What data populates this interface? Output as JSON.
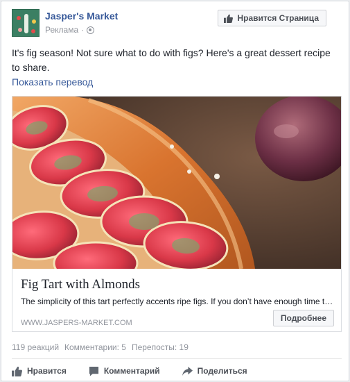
{
  "post": {
    "page_name": "Jasper's Market",
    "sponsored_label": "Реклама",
    "separator": "·",
    "like_page_label": "Нравится Страница",
    "text": "It's fig season! Not sure what to do with figs? Here's a great dessert recipe to share.",
    "translate_label": "Показать перевод"
  },
  "link": {
    "title": "Fig Tart with Almonds",
    "description": "The simplicity of this tart perfectly accents ripe figs. If you don’t have enough time t…",
    "domain": "WWW.JASPERS-MARKET.COM",
    "cta_label": "Подробнее"
  },
  "stats": {
    "reactions": "119 реакций",
    "comments": "Комментарии: 5",
    "shares": "Перепосты: 19"
  },
  "actions": {
    "like": "Нравится",
    "comment": "Комментарий",
    "share": "Поделиться"
  },
  "icons": {
    "avatar": "jaspers-market-logo",
    "globe": "globe-icon",
    "like": "thumbs-up-icon",
    "comment": "comment-icon",
    "share": "share-arrow-icon"
  },
  "colors": {
    "link_blue": "#365899",
    "muted_text": "#90949c",
    "button_bg": "#f6f7f9",
    "border": "#dddfe2"
  }
}
